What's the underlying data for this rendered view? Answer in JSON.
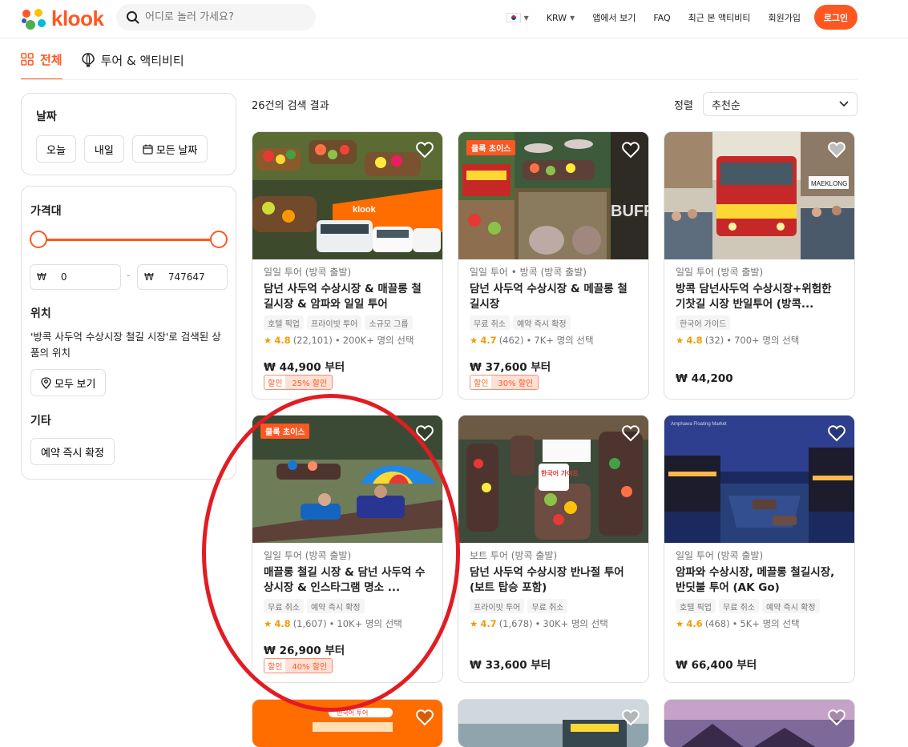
{
  "header": {
    "logo_text": "klook",
    "search_placeholder": "어디로 놀러 가세요?",
    "nav": {
      "currency": "KRW",
      "app": "앱에서 보기",
      "faq": "FAQ",
      "recent": "최근 본 액티비티",
      "signup": "회원가입",
      "login": "로그인"
    }
  },
  "tabs": [
    {
      "label": "전체",
      "active": true
    },
    {
      "label": "투어 & 액티비티",
      "active": false
    }
  ],
  "filters": {
    "date": {
      "title": "날짜",
      "today": "오늘",
      "tomorrow": "내일",
      "all_dates": "모든 날짜"
    },
    "price": {
      "title": "가격대",
      "currency_symbol": "₩",
      "min": "0",
      "max": "747647",
      "separator": "-"
    },
    "location": {
      "title": "위치",
      "desc": "'방콕 사두억 수상시장 철길 시장'로 검색된 상품의 위치",
      "view_all": "모두 보기"
    },
    "other": {
      "title": "기타",
      "instant": "예약 즉시 확정"
    }
  },
  "results": {
    "count_text": "26건의 검색 결과",
    "sort_label": "정렬",
    "sort_value": "추천순"
  },
  "cards": [
    {
      "category": "일일 투어 (방콕 출발)",
      "title": "담넌 사두억 수상시장 & 매끌롱 철길시장 & 암파와 일일 투어",
      "tags": [
        "호텔 픽업",
        "프라이빗 투어",
        "소규모 그룹"
      ],
      "score": "4.8",
      "reviews": "(22,101)",
      "booked": "200K+ 명의 선택",
      "price": "₩ 44,900 부터",
      "disc_label": "할인",
      "disc_value": "25% 할인",
      "badge": ""
    },
    {
      "category": "일일 투어 • 방콕 (방콕 출발)",
      "title": "담넌 사두억 수상시장 & 메끌롱 철길시장",
      "tags": [
        "무료 취소",
        "예약 즉시 확정"
      ],
      "score": "4.7",
      "reviews": "(462)",
      "booked": "7K+ 명의 선택",
      "price": "₩ 37,600 부터",
      "disc_label": "할인",
      "disc_value": "30% 할인",
      "badge": "클룩 초이스"
    },
    {
      "category": "일일 투어 (방콕 출발)",
      "title": "방콕 담넌사두억 수상시장+위험한 기찻길 시장 반일투어 (방콕...",
      "tags": [
        "한국어 가이드"
      ],
      "score": "4.8",
      "reviews": "(32)",
      "booked": "700+ 명의 선택",
      "price": "₩ 44,200",
      "disc_label": "",
      "disc_value": "",
      "badge": ""
    },
    {
      "category": "일일 투어 (방콕 출발)",
      "title": "매끌롱 철길 시장 & 담넌 사두억 수상시장 & 인스타그램 명소 ...",
      "tags": [
        "무료 취소",
        "예약 즉시 확정"
      ],
      "score": "4.8",
      "reviews": "(1,607)",
      "booked": "10K+ 명의 선택",
      "price": "₩ 26,900 부터",
      "disc_label": "할인",
      "disc_value": "40% 할인",
      "badge": "클룩 초이스"
    },
    {
      "category": "보트 투어 (방콕 출발)",
      "title": "담넌 사두억 수상시장 반나절 투어 (보트 탑승 포함)",
      "tags": [
        "프라이빗 투어",
        "무료 취소"
      ],
      "score": "4.7",
      "reviews": "(1,678)",
      "booked": "30K+ 명의 선택",
      "price": "₩ 33,600 부터",
      "disc_label": "",
      "disc_value": "",
      "badge": ""
    },
    {
      "category": "일일 투어 (방콕 출발)",
      "title": "암파와 수상시장, 메끌롱 철길시장, 반딧불 투어 (AK Go)",
      "tags": [
        "호텔 픽업",
        "무료 취소",
        "예약 즉시 확정"
      ],
      "score": "4.6",
      "reviews": "(468)",
      "booked": "5K+ 명의 선택",
      "price": "₩ 66,400 부터",
      "disc_label": "",
      "disc_value": "",
      "badge": ""
    }
  ],
  "image_text": {
    "card1_brand": "klook",
    "card2_sign": "BUFFA",
    "card3_sign": "MAEKLONG",
    "card5_sign": "한국어 가이드",
    "card6_sign": "Amphawa Floating Market",
    "row3_badge": "한국어 투어"
  }
}
